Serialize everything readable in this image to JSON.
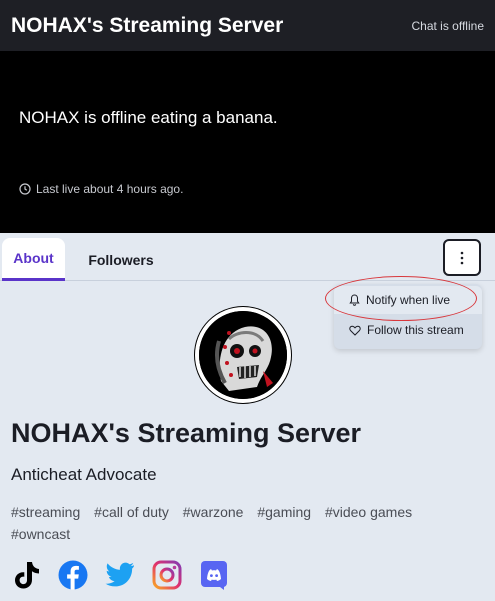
{
  "header": {
    "title": "NOHAX's Streaming Server",
    "chat_status": "Chat is offline"
  },
  "offline": {
    "message": "NOHAX is offline eating a banana.",
    "last_live": "Last live about 4 hours ago."
  },
  "tabs": [
    {
      "label": "About",
      "active": true
    },
    {
      "label": "Followers",
      "active": false
    }
  ],
  "menu": {
    "items": [
      {
        "label": "Notify when live",
        "icon": "bell-icon"
      },
      {
        "label": "Follow this stream",
        "icon": "heart-icon"
      }
    ]
  },
  "profile": {
    "name": "NOHAX's Streaming Server",
    "tagline": "Anticheat Advocate",
    "tags": [
      "#streaming",
      "#call of duty",
      "#warzone",
      "#gaming",
      "#video games",
      "#owncast"
    ]
  },
  "socials": [
    {
      "name": "TikTok",
      "icon": "tiktok-icon",
      "color": "#000000"
    },
    {
      "name": "Facebook",
      "icon": "facebook-icon",
      "color": "#1877f2"
    },
    {
      "name": "Twitter",
      "icon": "twitter-icon",
      "color": "#1da1f2"
    },
    {
      "name": "Instagram",
      "icon": "instagram-icon",
      "color": "#e1306c"
    },
    {
      "name": "Discord",
      "icon": "discord-icon",
      "color": "#5865f2"
    }
  ],
  "colors": {
    "header_bg": "#1e1f25",
    "accent": "#5a34c9",
    "page_bg": "#e3e9f1",
    "highlight": "#d8373c"
  }
}
